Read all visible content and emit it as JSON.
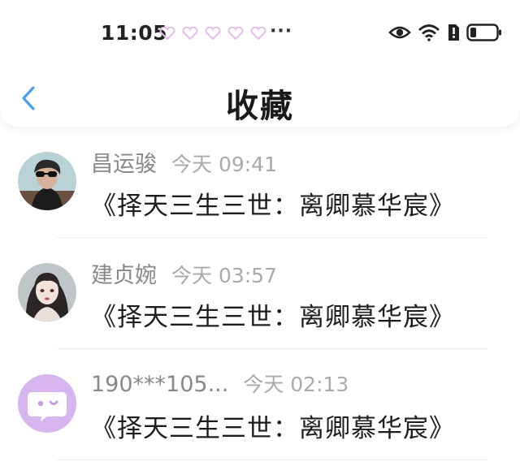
{
  "status_bar": {
    "time": "11:05",
    "more": "···"
  },
  "header": {
    "title": "收藏"
  },
  "colors": {
    "accent": "#4a9df0",
    "heart": "#e7c6ee",
    "avatar3_bg": "#d7b6ef"
  },
  "items": [
    {
      "name": "昌运骏",
      "time": "今天 09:41",
      "content": "《择天三生三世：离卿慕华宸》"
    },
    {
      "name": "建贞婉",
      "time": "今天 03:57",
      "content": "《择天三生三世：离卿慕华宸》"
    },
    {
      "name": "190***105...",
      "time": "今天 02:13",
      "content": "《择天三生三世：离卿慕华宸》"
    }
  ]
}
